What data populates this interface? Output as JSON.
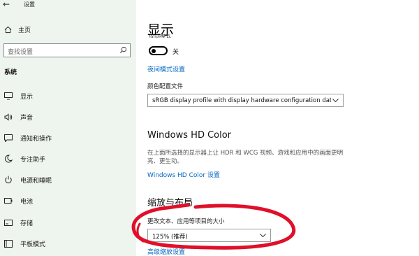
{
  "window": {
    "title": "设置"
  },
  "sidebar": {
    "home_label": "主页",
    "search_placeholder": "查找设置",
    "section_header": "系统",
    "items": [
      {
        "label": "显示",
        "icon": "monitor-icon"
      },
      {
        "label": "声音",
        "icon": "speaker-icon"
      },
      {
        "label": "通知和操作",
        "icon": "notification-icon"
      },
      {
        "label": "专注助手",
        "icon": "moon-icon"
      },
      {
        "label": "电源和睡眠",
        "icon": "power-icon"
      },
      {
        "label": "电池",
        "icon": "battery-icon"
      },
      {
        "label": "存储",
        "icon": "storage-icon"
      },
      {
        "label": "平板模式",
        "icon": "tablet-icon"
      }
    ]
  },
  "main": {
    "page_title": "显示",
    "night_light_partial": "夜间模式",
    "night_light_state": "关",
    "night_light_settings_link": "夜间模式设置",
    "color_profile_label": "颜色配置文件",
    "color_profile_value": "sRGB display profile with display hardware configuration data d...",
    "hd_color_title": "Windows HD Color",
    "hd_color_desc": "在上面所选择的显示器上让 HDR 和 WCG 视频、游戏和应用中的画面更明亮、更生动。",
    "hd_color_link": "Windows HD Color 设置",
    "scale_section_title": "缩放与布局",
    "scale_label": "更改文本、应用等项目的大小",
    "scale_value": "125% (推荐)",
    "advanced_scale_link": "高级缩放设置"
  },
  "colors": {
    "accent": "#0067c0",
    "sidebar_bg": "#eef4ee",
    "annotation": "#e0102a"
  }
}
